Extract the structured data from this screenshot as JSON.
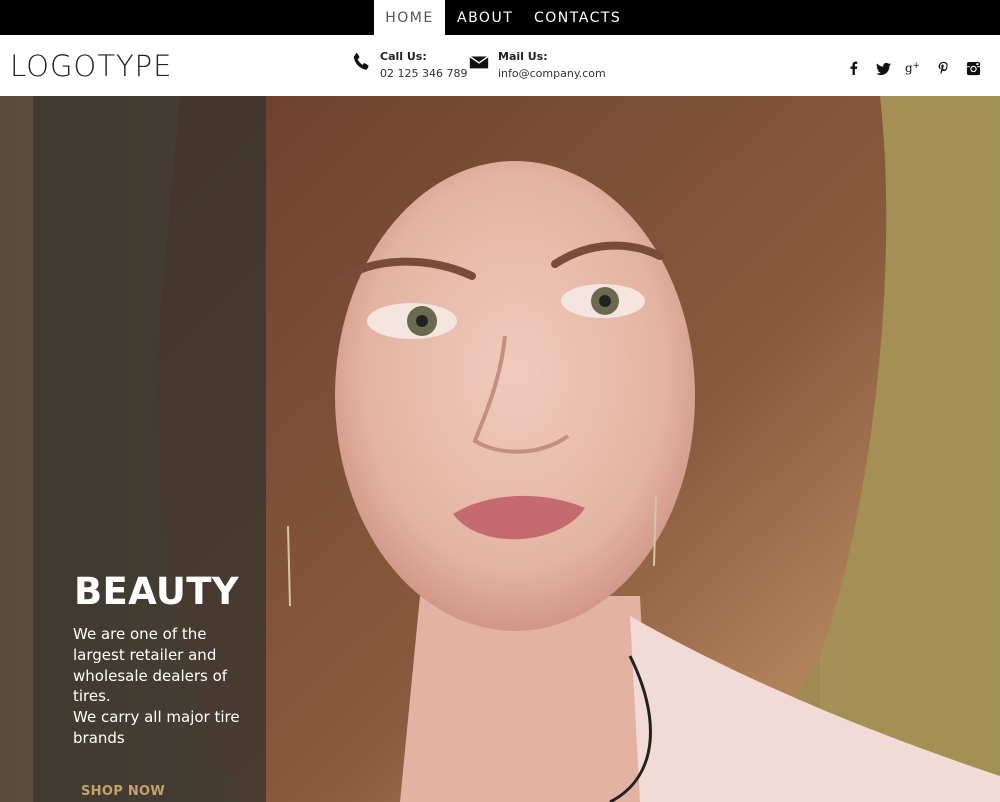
{
  "nav": {
    "items": [
      {
        "label": "HOME",
        "active": true
      },
      {
        "label": "ABOUT",
        "active": false
      },
      {
        "label": "CONTACTS",
        "active": false
      }
    ]
  },
  "header": {
    "logo": "LOGOTYPE",
    "call": {
      "label": "Call Us:",
      "value": "02 125 346 789",
      "icon": "phone-icon"
    },
    "mail": {
      "label": "Mail Us:",
      "value": "info@company.com",
      "icon": "envelope-icon"
    },
    "social": [
      "facebook-icon",
      "twitter-icon",
      "google-plus-icon",
      "pinterest-icon",
      "instagram-icon"
    ]
  },
  "hero": {
    "title": "BEAUTY",
    "line1": "We are one of the largest retailer and wholesale dealers of tires.",
    "line2": "We carry all major tire brands",
    "cta": "SHOP NOW"
  },
  "colors": {
    "nav_bg": "#000000",
    "panel_bg": "#37342d",
    "cta": "#c6a070"
  }
}
